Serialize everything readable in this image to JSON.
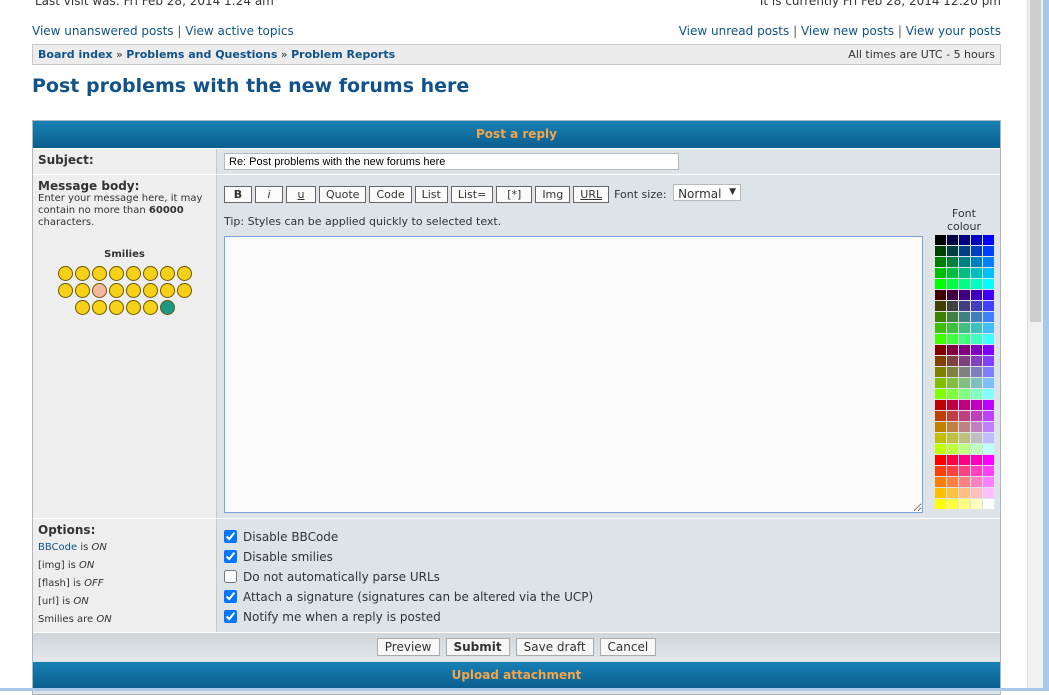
{
  "header": {
    "last_visit": "Last visit was: Fri Feb 28, 2014 1:24 am",
    "current_time": "It is currently Fri Feb 28, 2014 12:20 pm"
  },
  "links_left": [
    "View unanswered posts",
    "View active topics"
  ],
  "links_right": [
    "View unread posts",
    "View new posts",
    "View your posts"
  ],
  "breadcrumb": [
    "Board index",
    "Problems and Questions",
    "Problem Reports"
  ],
  "timezone": "All times are UTC - 5 hours",
  "page_title": "Post problems with the new forums here",
  "form": {
    "header": "Post a reply",
    "subject_label": "Subject:",
    "subject_value": "Re: Post problems with the new forums here",
    "body_label": "Message body:",
    "body_hint_pre": "Enter your message here, it may contain no more than ",
    "body_hint_count": "60000",
    "body_hint_post": " characters.",
    "smilies_label": "Smilies",
    "smilies_count": 22,
    "toolbar": [
      "B",
      "i",
      "u",
      "Quote",
      "Code",
      "List",
      "List=",
      "[*]",
      "Img",
      "URL"
    ],
    "font_size_label": "Font size:",
    "font_size_value": "Normal",
    "tip": "Tip: Styles can be applied quickly to selected text.",
    "font_colour_label": "Font colour",
    "message_value": "",
    "options_label": "Options:",
    "status": [
      {
        "name": "BBCode",
        "link": true,
        "text": " is ",
        "state": "ON"
      },
      {
        "name": "[img]",
        "text": " is ",
        "state": "ON"
      },
      {
        "name": "[flash]",
        "text": " is ",
        "state": "OFF"
      },
      {
        "name": "[url]",
        "text": " is ",
        "state": "ON"
      },
      {
        "name": "Smilies",
        "text": " are ",
        "state": "ON"
      }
    ],
    "options": [
      {
        "label": "Disable BBCode",
        "checked": true
      },
      {
        "label": "Disable smilies",
        "checked": true
      },
      {
        "label": "Do not automatically parse URLs",
        "checked": false
      },
      {
        "label": "Attach a signature (signatures can be altered via the UCP)",
        "checked": true
      },
      {
        "label": "Notify me when a reply is posted",
        "checked": true
      }
    ],
    "buttons": [
      "Preview",
      "Submit",
      "Save draft",
      "Cancel"
    ],
    "upload_header": "Upload attachment"
  },
  "colors": {
    "link": "#105289",
    "header_text": "#f5a54a",
    "bar": "#0b5e8e"
  }
}
